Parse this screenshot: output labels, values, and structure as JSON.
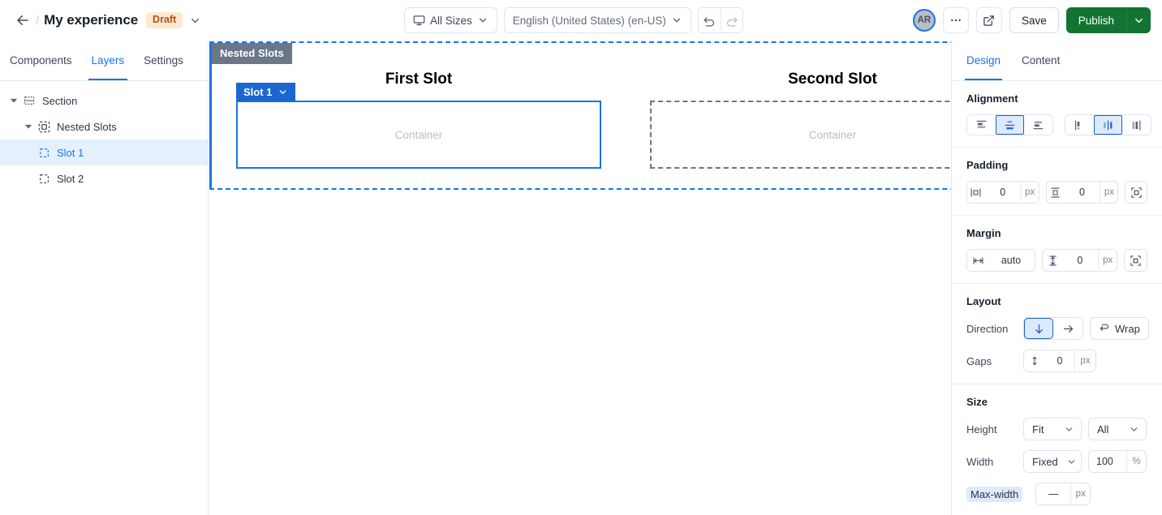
{
  "topbar": {
    "back_icon": "arrow-left-icon",
    "breadcrumb_separator": "/",
    "title": "My experience",
    "status_badge": "Draft",
    "title_caret_icon": "chevron-down-icon",
    "size_selector": {
      "label": "All Sizes",
      "icon": "monitor-icon",
      "caret": "chevron-down-icon"
    },
    "language_selector": {
      "label": "English (United States) (en-US)",
      "caret": "chevron-down-icon"
    },
    "undo_icon": "undo-icon",
    "redo_icon": "redo-icon",
    "avatar_initials": "AR",
    "more_icon": "ellipsis-icon",
    "preview_icon": "external-link-icon",
    "save_label": "Save",
    "publish_label": "Publish",
    "publish_caret_icon": "chevron-down-icon"
  },
  "left_panel": {
    "tabs": [
      {
        "label": "Components",
        "active": false
      },
      {
        "label": "Layers",
        "active": true
      },
      {
        "label": "Settings",
        "active": false
      }
    ],
    "tree": [
      {
        "label": "Section",
        "icon": "section-icon",
        "depth": 0,
        "expanded": true,
        "selected": false
      },
      {
        "label": "Nested Slots",
        "icon": "component-icon",
        "depth": 1,
        "expanded": true,
        "selected": false
      },
      {
        "label": "Slot 1",
        "icon": "slot-icon",
        "depth": 2,
        "expanded": null,
        "selected": true
      },
      {
        "label": "Slot 2",
        "icon": "slot-icon",
        "depth": 2,
        "expanded": null,
        "selected": false
      }
    ]
  },
  "canvas": {
    "section_badge": "Nested Slots",
    "slots": [
      {
        "title": "First Slot",
        "container_label": "Container",
        "badge": "Slot 1",
        "selected": true
      },
      {
        "title": "Second Slot",
        "container_label": "Container",
        "badge": null,
        "selected": false
      }
    ]
  },
  "right_panel": {
    "tabs": [
      {
        "label": "Design",
        "active": true
      },
      {
        "label": "Content",
        "active": false
      }
    ],
    "alignment": {
      "heading": "Alignment",
      "vertical": [
        {
          "icon": "align-top-icon",
          "active": false
        },
        {
          "icon": "align-middle-icon",
          "active": true
        },
        {
          "icon": "align-bottom-icon",
          "active": false
        }
      ],
      "horizontal": [
        {
          "icon": "align-left-icon",
          "active": false
        },
        {
          "icon": "align-center-icon",
          "active": true
        },
        {
          "icon": "align-right-icon",
          "active": false
        }
      ]
    },
    "padding": {
      "heading": "Padding",
      "horizontal": {
        "icon": "padding-horizontal-icon",
        "value": "0",
        "unit": "px"
      },
      "vertical": {
        "icon": "padding-vertical-icon",
        "value": "0",
        "unit": "px"
      },
      "expand_icon": "padding-all-icon"
    },
    "margin": {
      "heading": "Margin",
      "horizontal": {
        "icon": "margin-horizontal-icon",
        "value": "auto",
        "unit": ""
      },
      "vertical": {
        "icon": "margin-vertical-icon",
        "value": "0",
        "unit": "px"
      },
      "expand_icon": "margin-all-icon"
    },
    "layout": {
      "heading": "Layout",
      "direction_label": "Direction",
      "direction_options": [
        {
          "icon": "arrow-down-icon",
          "active": true
        },
        {
          "icon": "arrow-right-icon",
          "active": false
        }
      ],
      "wrap_label": "Wrap",
      "wrap_icon": "wrap-icon",
      "gaps_label": "Gaps",
      "gaps": {
        "icon": "gap-vertical-icon",
        "value": "0",
        "unit": "px"
      }
    },
    "size": {
      "heading": "Size",
      "height_label": "Height",
      "height_mode": "Fit",
      "height_scope": "All",
      "width_label": "Width",
      "width_mode": "Fixed",
      "width_value": "100",
      "width_unit": "%",
      "maxwidth_label": "Max-width",
      "maxwidth_value": "—",
      "maxwidth_unit": "px"
    }
  },
  "colors": {
    "accent": "#1a73e8",
    "publish": "#137333",
    "badge_gray": "#6b7688",
    "slot_blue": "#1a67d2",
    "draft_bg": "#fde9cf",
    "draft_fg": "#b5521c"
  }
}
